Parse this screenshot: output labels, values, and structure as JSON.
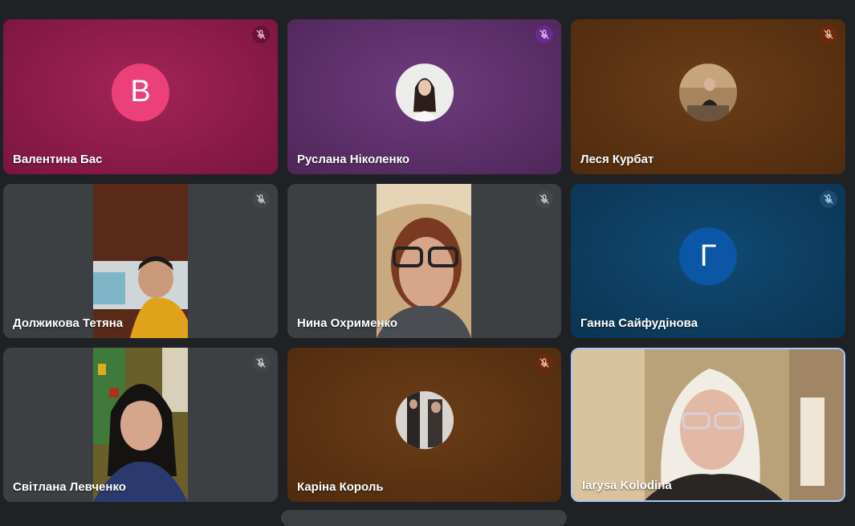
{
  "participants": [
    {
      "name": "Валентина Бас",
      "initial": "В",
      "avatar_color": "#ec407a",
      "type": "initial",
      "bg": "#8e1a48"
    },
    {
      "name": "Руслана Ніколенко",
      "type": "photo-avatar",
      "bg": "#5b2f68"
    },
    {
      "name": "Леся Курбат",
      "type": "photo-avatar",
      "bg": "#5a3414"
    },
    {
      "name": "Должикова Тетяна",
      "type": "video",
      "bg": "#3c4043"
    },
    {
      "name": "Нина Охрименко",
      "type": "video",
      "bg": "#3c4043"
    },
    {
      "name": "Ганна Сайфудінова",
      "initial": "Г",
      "avatar_color": "#0b57a6",
      "type": "initial",
      "bg": "#0d3b5e"
    },
    {
      "name": "Світлана Левченко",
      "type": "video",
      "bg": "#3c4043"
    },
    {
      "name": "Каріна Король",
      "type": "photo-avatar",
      "bg": "#5a3414"
    },
    {
      "name": "Iarysa Kolodina",
      "type": "video",
      "bg": "#3c4043",
      "speaking": true
    }
  ],
  "colors": {
    "page_bg": "#202124",
    "speaking_border": "#a8c7fa",
    "mute_pink": "#6a1036",
    "mute_purple": "#6b2a8f",
    "mute_brown": "#6b2a0e",
    "mute_grey": "#44474a",
    "mute_blue": "#1b4b70"
  }
}
